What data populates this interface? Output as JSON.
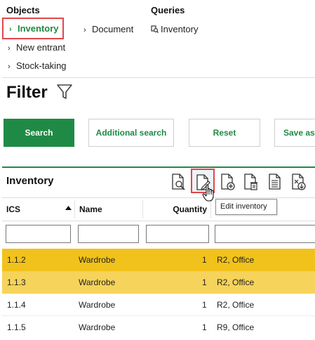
{
  "nav": {
    "objects_header": "Objects",
    "queries_header": "Queries",
    "objects": [
      {
        "label": "Inventory",
        "active": true
      },
      {
        "label": "New entrant"
      },
      {
        "label": "Stock-taking"
      }
    ],
    "document_label": "Document",
    "queries": [
      {
        "label": "Inventory",
        "icon": "query-icon"
      }
    ]
  },
  "filter": {
    "title": "Filter",
    "icon": "funnel-icon",
    "buttons": {
      "search": "Search",
      "additional_search": "Additional search",
      "reset": "Reset",
      "save_as": "Save as"
    }
  },
  "panel": {
    "title": "Inventory",
    "toolbar_icons": [
      "view-document-icon",
      "edit-document-icon",
      "add-document-icon",
      "delete-document-icon",
      "list-document-icon",
      "export-document-icon"
    ],
    "tooltip": "Edit inventory"
  },
  "table": {
    "columns": [
      "ICS",
      "Name",
      "Quantity"
    ],
    "sort": {
      "column": "ICS",
      "direction": "ascending"
    },
    "rows": [
      {
        "ics": "1.1.2",
        "name": "Wardrobe",
        "quantity": "1",
        "location": "R2, Office",
        "state": "selected"
      },
      {
        "ics": "1.1.3",
        "name": "Wardrobe",
        "quantity": "1",
        "location": "R2, Office",
        "state": "highlighted"
      },
      {
        "ics": "1.1.4",
        "name": "Wardrobe",
        "quantity": "1",
        "location": "R2, Office",
        "state": "normal"
      },
      {
        "ics": "1.1.5",
        "name": "Wardrobe",
        "quantity": "1",
        "location": "R9, Office",
        "state": "normal"
      }
    ]
  },
  "colors": {
    "accent_green": "#1f8a45",
    "selection_red": "#e0474c",
    "row_selected": "#f1c21b",
    "row_highlighted": "#f6d35a"
  }
}
